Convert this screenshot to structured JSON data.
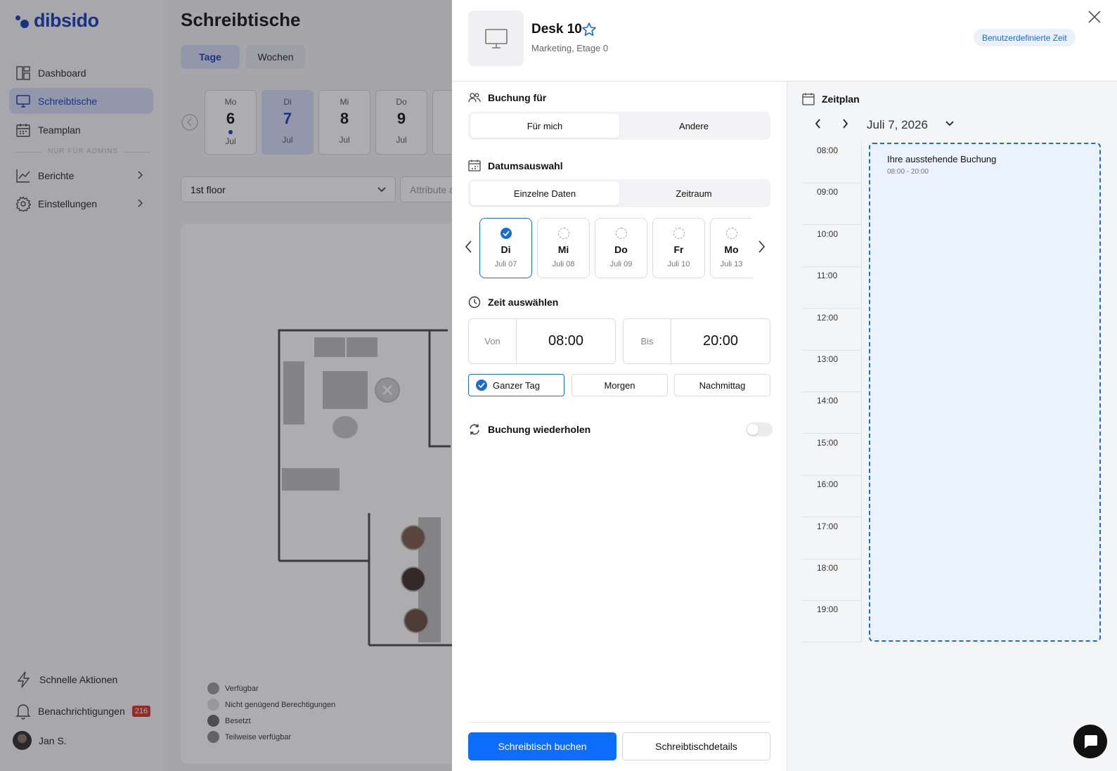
{
  "app": {
    "logo": "dibsido",
    "sidebar": {
      "items": [
        {
          "label": "Dashboard",
          "icon": "dashboard-icon"
        },
        {
          "label": "Schreibtische",
          "icon": "desk-monitor-icon"
        },
        {
          "label": "Teamplan",
          "icon": "calendar-grid-icon"
        },
        {
          "label": "Berichte",
          "icon": "chart-icon"
        },
        {
          "label": "Einstellungen",
          "icon": "gear-icon"
        }
      ],
      "admins_label": "NUR FÜR ADMINS",
      "quick_actions": "Schnelle Aktionen",
      "notifications": "Benachrichtigungen",
      "notifications_count": "216",
      "user": "Jan S."
    },
    "page_title": "Schreibtische",
    "view_tabs": [
      "Tage",
      "Wochen"
    ],
    "dates": [
      {
        "wd": "Mo",
        "day": "6",
        "month": "Jul"
      },
      {
        "wd": "Di",
        "day": "7",
        "month": "Jul"
      },
      {
        "wd": "Mi",
        "day": "8",
        "month": "Jul"
      },
      {
        "wd": "Do",
        "day": "9",
        "month": "Jul"
      }
    ],
    "floor_select": "1st floor",
    "attribute_placeholder": "Attribute a",
    "legend": [
      "Verfügbar",
      "Nicht genügend Berechtigungen",
      "Besetzt",
      "Teilweise verfügbar"
    ]
  },
  "panel": {
    "desk_title": "Desk 10",
    "desk_subtitle": "Marketing, Etage 0",
    "custom_time": "Benutzerdefinierte Zeit",
    "booking_for": {
      "title": "Buchung für",
      "options": [
        "Für mich",
        "Andere"
      ]
    },
    "date_select": {
      "title": "Datumsauswahl",
      "options": [
        "Einzelne Daten",
        "Zeitraum"
      ],
      "days": [
        {
          "name": "Di",
          "date": "Juli 07"
        },
        {
          "name": "Mi",
          "date": "Juli 08"
        },
        {
          "name": "Do",
          "date": "Juli 09"
        },
        {
          "name": "Fr",
          "date": "Juli 10"
        },
        {
          "name": "Mo",
          "date": "Juli 13"
        }
      ]
    },
    "time_select": {
      "title": "Zeit auswählen",
      "from_label": "Von",
      "from_value": "08:00",
      "to_label": "Bis",
      "to_value": "20:00",
      "presets": [
        "Ganzer Tag",
        "Morgen",
        "Nachmittag"
      ]
    },
    "repeat": {
      "title": "Buchung wiederholen",
      "enabled": false
    },
    "buttons": {
      "book": "Schreibtisch buchen",
      "details": "Schreibtischdetails"
    },
    "schedule": {
      "title": "Zeitplan",
      "date": "Juli 7, 2026",
      "hours": [
        "08:00",
        "09:00",
        "10:00",
        "11:00",
        "12:00",
        "13:00",
        "14:00",
        "15:00",
        "16:00",
        "17:00",
        "18:00",
        "19:00"
      ],
      "booking_title": "Ihre ausstehende Buchung",
      "booking_time": "08:00 - 20:00"
    }
  },
  "colors": {
    "brand": "#1338b8",
    "accent": "#1a6bd6",
    "primary_button": "#0d6efd"
  }
}
